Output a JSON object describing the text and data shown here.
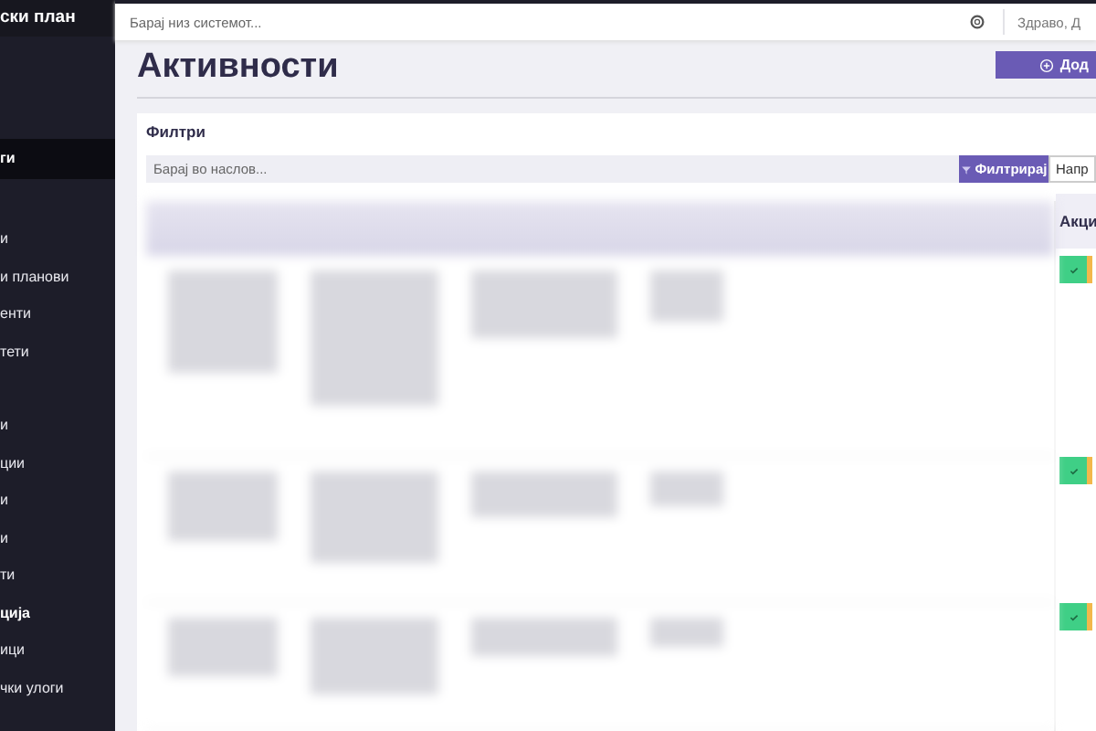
{
  "sidebar": {
    "title": "ски план",
    "items": [
      {
        "label": "ги",
        "kind": "item",
        "selected": true
      },
      {
        "label": "и",
        "kind": "item",
        "selected": false
      },
      {
        "label": "и планови",
        "kind": "item",
        "selected": false
      },
      {
        "label": "енти",
        "kind": "item",
        "selected": false
      },
      {
        "label": "тети",
        "kind": "item",
        "selected": false
      },
      {
        "label": "и",
        "kind": "item",
        "selected": false,
        "group_start": true
      },
      {
        "label": "ции",
        "kind": "item",
        "selected": false
      },
      {
        "label": "и",
        "kind": "item",
        "selected": false
      },
      {
        "label": "и",
        "kind": "item",
        "selected": false
      },
      {
        "label": "ти",
        "kind": "item",
        "selected": false
      },
      {
        "label": "ција",
        "kind": "section",
        "selected": false
      },
      {
        "label": "ици",
        "kind": "item",
        "selected": false
      },
      {
        "label": "чки улоги",
        "kind": "item",
        "selected": false
      }
    ]
  },
  "topbar": {
    "search": {
      "placeholder": "Барај низ системот..."
    },
    "greeting": "Здраво, Д"
  },
  "page": {
    "title": "Активности",
    "add_button": "Дод"
  },
  "filters": {
    "title": "Филтри",
    "search": {
      "placeholder": "Барај во наслов..."
    },
    "filter_button": "Филтрирај",
    "second_button": "Напр"
  },
  "table": {
    "columns": [
      "Акци"
    ],
    "rows": [
      {
        "kind": "tall"
      },
      {
        "kind": "medium"
      },
      {
        "kind": "short"
      }
    ]
  }
}
